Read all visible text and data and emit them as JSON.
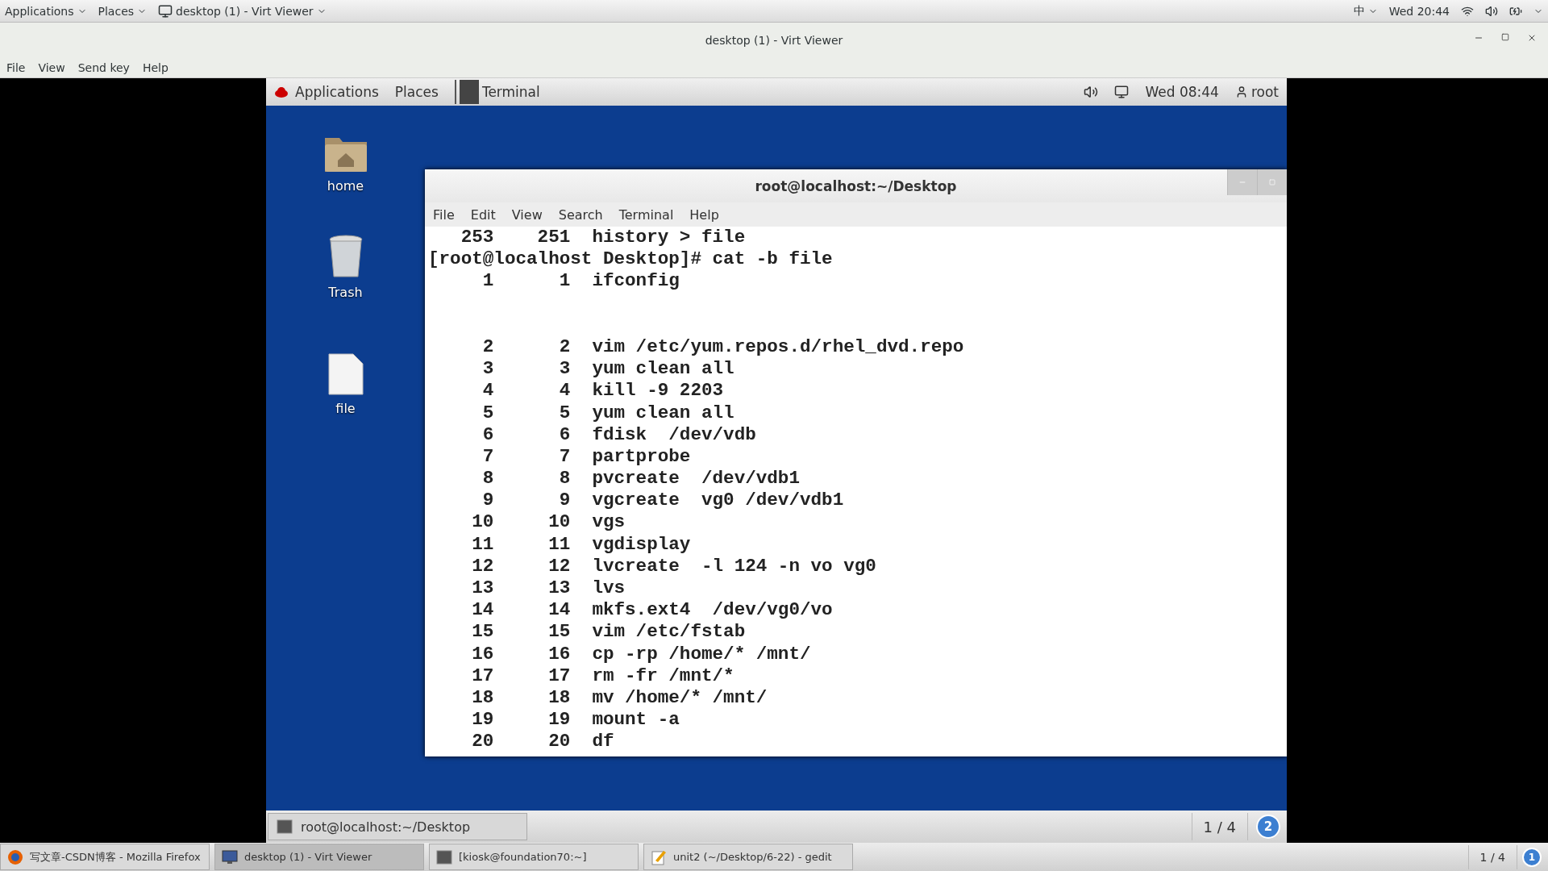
{
  "host_top_bar": {
    "menus": [
      {
        "label": "Applications"
      },
      {
        "label": "Places"
      }
    ],
    "window_switcher": "desktop (1) - Virt Viewer",
    "input_method": "中",
    "clock": "Wed 20:44"
  },
  "window": {
    "title": "desktop (1) - Virt Viewer",
    "menu": [
      "File",
      "View",
      "Send key",
      "Help"
    ]
  },
  "guest": {
    "top_panel": {
      "menus": [
        "Applications",
        "Places"
      ],
      "active_app": "Terminal",
      "clock": "Wed 08:44",
      "user": "root"
    },
    "desktop_icons": [
      {
        "kind": "folder",
        "label": "home"
      },
      {
        "kind": "trash",
        "label": "Trash"
      },
      {
        "kind": "document",
        "label": "file"
      }
    ],
    "terminal": {
      "title": "root@localhost:~/Desktop",
      "menu": [
        "File",
        "Edit",
        "View",
        "Search",
        "Terminal",
        "Help"
      ],
      "lines": [
        "   253    251  history > file",
        "[root@localhost Desktop]# cat -b file",
        "     1      1  ifconfig",
        {
          "kind": "blank"
        },
        {
          "kind": "blank"
        },
        "     2      2  vim /etc/yum.repos.d/rhel_dvd.repo",
        "     3      3  yum clean all",
        "     4      4  kill -9 2203",
        "     5      5  yum clean all",
        "     6      6  fdisk  /dev/vdb",
        "     7      7  partprobe",
        "     8      8  pvcreate  /dev/vdb1",
        "     9      9  vgcreate  vg0 /dev/vdb1",
        "    10     10  vgs",
        "    11     11  vgdisplay",
        "    12     12  lvcreate  -l 124 -n vo vg0",
        "    13     13  lvs",
        "    14     14  mkfs.ext4  /dev/vg0/vo",
        "    15     15  vim /etc/fstab",
        "    16     16  cp -rp /home/* /mnt/",
        "    17     17  rm -fr /mnt/*",
        "    18     18  mv /home/* /mnt/",
        "    19     19  mount -a",
        "    20     20  df"
      ]
    },
    "bottom_panel": {
      "tasks": [
        {
          "label": "root@localhost:~/Desktop",
          "selected": false
        }
      ],
      "workspace": "1 / 4",
      "badge": "2"
    }
  },
  "host_taskbar": {
    "tasks": [
      {
        "kind": "browser",
        "label": "写文章-CSDN博客 - Mozilla Firefox",
        "selected": false
      },
      {
        "kind": "viewer",
        "label": "desktop (1) - Virt Viewer",
        "selected": true
      },
      {
        "kind": "terminal",
        "label": "[kiosk@foundation70:~]",
        "selected": false
      },
      {
        "kind": "editor",
        "label": "unit2 (~/Desktop/6-22) - gedit",
        "selected": false
      }
    ],
    "workspace": "1 / 4",
    "badge": "1"
  }
}
